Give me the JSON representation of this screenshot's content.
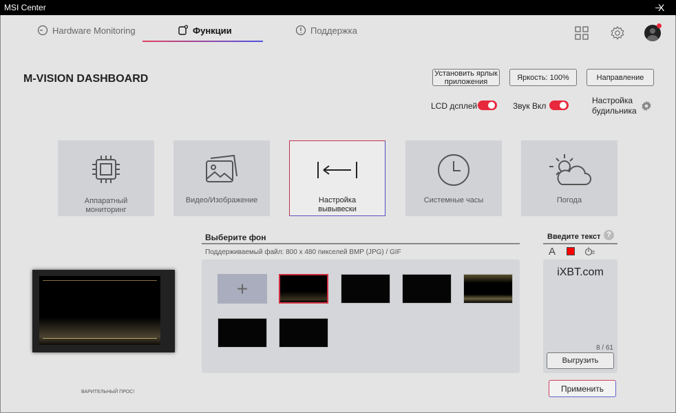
{
  "window": {
    "title": "MSI Center",
    "minimize": "–",
    "close": "X"
  },
  "tabs": [
    {
      "label": "Hardware Monitoring",
      "icon": "gauge-icon"
    },
    {
      "label": "Функции",
      "icon": "features-icon",
      "active": true
    },
    {
      "label": "Поддержка",
      "icon": "alert-bubble-icon"
    }
  ],
  "header": {
    "title": "M-VISION DASHBOARD",
    "shortcut_button": "Установить ярлык приложения",
    "brightness_button": "Яркость: 100%",
    "direction_button": "Направление",
    "lcd_label": "LCD дсплей",
    "lcd_on": true,
    "sound_label": "Звук Вкл",
    "sound_on": true,
    "alarm_label": "Настройка будильника"
  },
  "modes": [
    {
      "label": "Аппаратный мониторинг",
      "icon": "chip-icon"
    },
    {
      "label": "Видео/Изображение",
      "icon": "image-icon"
    },
    {
      "label": "Настройка вывывески",
      "icon": "arrow-left-icon",
      "selected": true
    },
    {
      "label": "Системные часы",
      "icon": "clock-icon"
    },
    {
      "label": "Погода",
      "icon": "weather-icon"
    }
  ],
  "background": {
    "title": "Выберите фон",
    "hint": "Поддерживаемый файл: 800 x 480 пикселей BMP (JPG) / GIF",
    "thumbnail_count": 7,
    "selected_index": 0
  },
  "text_panel": {
    "title": "Введите текст",
    "value": "iXBT.com",
    "counter": "8 / 61",
    "upload_button": "Выгрузить",
    "font_icon": "A",
    "text_color": "#ff0000"
  },
  "preview_label": "ВАРИТЕЛЬНЫЙ ПРОС!",
  "apply_button": "Применить",
  "colors": {
    "accent": "#e8283c",
    "toggle": "#e8283c"
  }
}
